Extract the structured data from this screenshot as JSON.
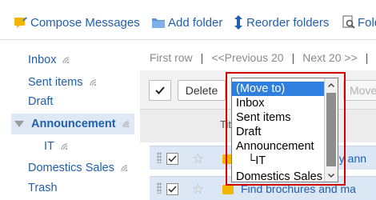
{
  "toolbar": {
    "compose": "Compose Messages",
    "add_folder": "Add folder",
    "reorder": "Reorder folders",
    "find": "Fold"
  },
  "sidebar": {
    "items": [
      {
        "label": "Inbox"
      },
      {
        "label": "Sent items"
      },
      {
        "label": "Draft"
      },
      {
        "label": "Announcement"
      },
      {
        "label": "IT"
      },
      {
        "label": "Domestics Sales"
      },
      {
        "label": "Trash"
      }
    ]
  },
  "pager": {
    "first": "First row",
    "sep": "|",
    "previous": "<<Previous 20",
    "next": "Next 20 >>"
  },
  "actions": {
    "delete": "Delete",
    "move": "Move"
  },
  "table": {
    "title_header": "Tit"
  },
  "rows": [
    {
      "subject": "ny ann"
    },
    {
      "subject": "Find brochures and ma"
    }
  ],
  "dropdown": {
    "options": [
      {
        "label": "(Move to)"
      },
      {
        "label": "Inbox"
      },
      {
        "label": "Sent items"
      },
      {
        "label": "Draft"
      },
      {
        "label": "Announcement"
      },
      {
        "label": "└IT"
      },
      {
        "label": "Domestics Sales"
      }
    ]
  },
  "colors": {
    "link": "#1f5fae",
    "selected_option": "#2f7fde",
    "highlight_frame": "#d40000",
    "selected_row": "#dbe7f5"
  }
}
